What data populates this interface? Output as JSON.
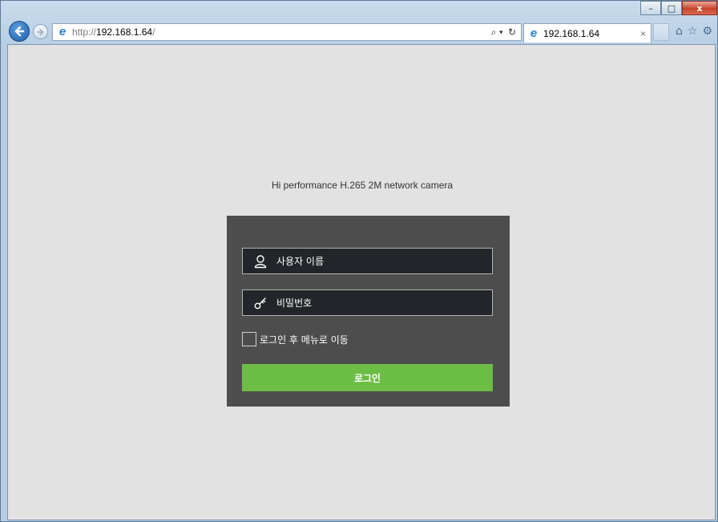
{
  "browser": {
    "window_controls": {
      "minimize": "–",
      "maximize": "□",
      "close": "x"
    },
    "nav": {
      "back_icon": "back-arrow-icon",
      "forward_icon": "forward-arrow-icon"
    },
    "address": {
      "prefix": "http://",
      "host": "192.168.1.64",
      "suffix": "/",
      "search_glyph": "⌕ ▾",
      "refresh_glyph": "↻"
    },
    "tab": {
      "title": "192.168.1.64",
      "close": "×"
    },
    "tools": {
      "home": "⌂",
      "favorites": "☆",
      "settings": "⚙"
    }
  },
  "page": {
    "product_title": "Hi performance H.265 2M network camera",
    "login": {
      "username_placeholder": "사용자 이름",
      "password_placeholder": "비밀번호",
      "remember_label": "로그인 후 메뉴로 이동",
      "login_button": "로그인"
    }
  },
  "colors": {
    "page_bg": "#e2e2e2",
    "panel_bg": "#4d4d4d",
    "field_bg": "#22252a",
    "login_button": "#6cbd45"
  }
}
